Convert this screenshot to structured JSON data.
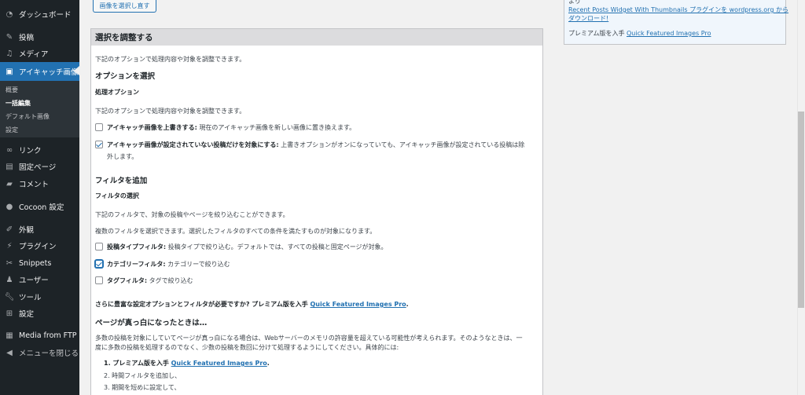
{
  "sidebar": {
    "items": [
      {
        "label": "ダッシュボード",
        "icon": "dashboard-icon"
      },
      {
        "label": "投稿",
        "icon": "pin-icon"
      },
      {
        "label": "メディア",
        "icon": "media-icon"
      },
      {
        "label": "アイキャッチ画像",
        "icon": "image-icon"
      },
      {
        "label": "リンク",
        "icon": "link-icon"
      },
      {
        "label": "固定ページ",
        "icon": "page-icon"
      },
      {
        "label": "コメント",
        "icon": "comment-icon"
      },
      {
        "label": "Cocoon 設定",
        "icon": "cocoon-icon"
      },
      {
        "label": "外観",
        "icon": "appearance-icon"
      },
      {
        "label": "プラグイン",
        "icon": "plugin-icon"
      },
      {
        "label": "Snippets",
        "icon": "snippets-icon"
      },
      {
        "label": "ユーザー",
        "icon": "user-icon"
      },
      {
        "label": "ツール",
        "icon": "tools-icon"
      },
      {
        "label": "設定",
        "icon": "settings-icon"
      },
      {
        "label": "Media from FTP",
        "icon": "ftp-icon"
      },
      {
        "label": "メニューを閉じる",
        "icon": "collapse-icon"
      }
    ],
    "submenu": [
      "概要",
      "一括編集",
      "デフォルト画像",
      "設定"
    ]
  },
  "top_button": "画像を選択し直す",
  "panel": {
    "title": "選択を調整する",
    "intro": "下記のオプションで処理内容や対象を調整できます。",
    "options_heading": "オプションを選択",
    "processing_options": "処理オプション",
    "options_desc": "下記のオプションで処理内容や対象を調整できます。",
    "opt1_bold": "アイキャッチ画像を上書きする:",
    "opt1_text": " 現在のアイキャッチ画像を新しい画像に置き換えます。",
    "opt1_checked": false,
    "opt2_bold": "アイキャッチ画像が設定されていない投稿だけを対象にする:",
    "opt2_text": " 上書きオプションがオンになっていても、アイキャッチ画像が設定されている投稿は除",
    "opt2_text2": "外します。",
    "opt2_checked": true,
    "filters_heading": "フィルタを追加",
    "filter_select": "フィルタの選択",
    "filter_desc1": "下記のフィルタで、対象の投稿やページを絞り込むことができます。",
    "filter_desc2": "複数のフィルタを選択できます。選択したフィルタのすべての条件を満たすものが対象になります。",
    "f1_bold": "投稿タイプフィルタ:",
    "f1_text": " 投稿タイプで絞り込む。デフォルトでは、すべての投稿と固定ページが対象。",
    "f1_checked": false,
    "f2_bold": "カテゴリーフィルタ:",
    "f2_text": " カテゴリーで絞り込む",
    "f2_checked": true,
    "f3_bold": "タグフィルタ:",
    "f3_text": " タグで絞り込む",
    "f3_checked": false,
    "promo_text": "さらに豊富な設定オプションとフィルタが必要ですか? プレミアム版を入手 ",
    "promo_link": "Quick Featured Images Pro",
    "promo_end": ".",
    "blank_heading": "ページが真っ白になったときは…",
    "blank_desc1": "多数の投稿を対象にしていてページが真っ白になる場合は、Webサーバーのメモリの許容量を超えている可能性が考えられます。そのようなときは、一",
    "blank_desc2": "度に多数の投稿を処理するのでなく、少数の投稿を数回に分けて処理するようにしてください。具体的には:",
    "step1_text": "1. プレミアム版を入手 ",
    "step1_link": "Quick Featured Images Pro",
    "step1_end": ".",
    "step2": "2. 時間フィルタを追加し、",
    "step3": "3. 期間を短めに設定して、"
  },
  "right_box": {
    "line0": "より",
    "link1": "Recent Posts Widget With Thumbnails プラグインを wordpress.org から",
    "link2": "ダウンロード!",
    "premium_text": "プレミアム版を入手 ",
    "premium_link": "Quick Featured Images Pro"
  }
}
